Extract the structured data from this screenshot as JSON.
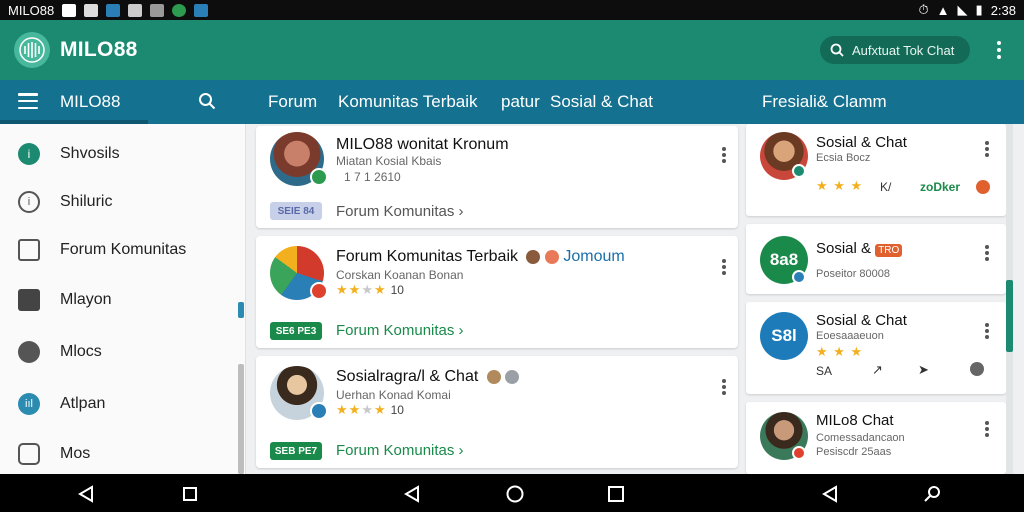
{
  "status_bar": {
    "carrier": "MILO88",
    "time": "2:38"
  },
  "app_bar": {
    "title": "MILO88",
    "search_label": "Aufxtuat Tok Chat"
  },
  "nav_bar": {
    "title": "MILO88",
    "links": [
      "Forum",
      "Komunitas Terbaik",
      "patur",
      "Sosial & Chat",
      "Fresiali& Clamm"
    ]
  },
  "sidebar": {
    "items": [
      {
        "label": "Shvosils",
        "icon": "info-icon"
      },
      {
        "label": "Shiluric",
        "icon": "hexagon-icon"
      },
      {
        "label": "Forum Komunitas",
        "icon": "image-icon"
      },
      {
        "label": "Mlayon",
        "icon": "bag-icon"
      },
      {
        "label": "Mlocs",
        "icon": "circle-icon"
      },
      {
        "label": "Atlpan",
        "icon": "chart-icon"
      },
      {
        "label": "Mos",
        "icon": "box-icon"
      }
    ]
  },
  "feed": [
    {
      "title": "MILO88 wonitat Kronum",
      "subtitle": "Miatan Kosial Kbais",
      "meta": "1 7 1 2610",
      "tag": "SEIE 84",
      "link": "Forum Komunitas",
      "extra": ""
    },
    {
      "title": "Forum Komunitas Terbaik",
      "subtitle": "Corskan Koanan Bonan",
      "rating_count": "10",
      "tag": "SE6 PE3",
      "link": "Forum Komunitas",
      "extra": "Jomoum"
    },
    {
      "title": "Sosialragra/l & Chat",
      "subtitle": "Uerhan Konad Komai",
      "rating_count": "10",
      "tag": "SEB PE7",
      "link": "Forum Komunitas",
      "extra": ""
    }
  ],
  "right_cards": [
    {
      "title": "Sosial & Chat",
      "subtitle": "Ecsia Bocz",
      "footer_mid": "K/",
      "footer_right": "zoDker"
    },
    {
      "title": "Sosial &",
      "badge_text": "TRO",
      "subtitle": "Poseitor 80008",
      "avatar_text": "8a8"
    },
    {
      "title": "Sosial & Chat",
      "subtitle": "Eoesaaaeuon",
      "footer_left": "SA",
      "avatar_text": "S8l"
    },
    {
      "title": "MILo8 Chat",
      "subtitle": "Comessadancaon",
      "subtitle2": "Pesiscdr 25aas"
    }
  ],
  "colors": {
    "app_bar": "#1c8a70",
    "nav_bar": "#14718f",
    "link_green": "#1a8a4a",
    "tag_green": "#1a8a4a",
    "tag_blue": "#c8cfe8",
    "star": "#f2b01e"
  }
}
